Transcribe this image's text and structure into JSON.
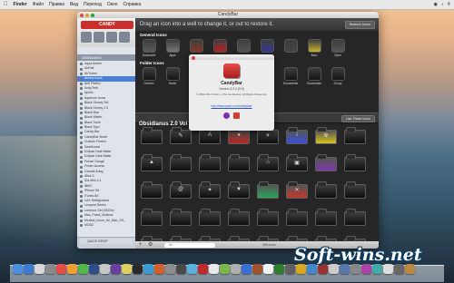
{
  "menubar": {
    "apple": "",
    "items": [
      "Finder",
      "Файл",
      "Правка",
      "Вид",
      "Переход",
      "Окно",
      "Справка"
    ]
  },
  "window": {
    "title": "CandyBar"
  },
  "sidebar": {
    "logo_text": "CANDY",
    "section_header": "OBSIDIANS",
    "items": [
      "Aqua Amber",
      "AirRail",
      "AirTunes",
      "Amora Icons",
      "Anti Firefox",
      "AndyTech",
      "Apollo",
      "Aqueous Icons",
      "Black Glossy Set",
      "Black Glossy 2.0",
      "Black Mac",
      "Black Watch",
      "Black Tools",
      "Black Typo",
      "Candy Bar",
      "CandyBar Mode",
      "Custom Firefox",
      "Dashboard",
      "Eclipse Dark Matte",
      "Eclipse Dark Matte",
      "Ferrari Gauge",
      "Finder Access",
      "Gnome Aring",
      "iDisk X",
      "iOs Mini 4.1",
      "iBMC",
      "iPhone Sit",
      "iTunes 8X",
      "LAX Refrigerated",
      "Leopard Series",
      "Luminox Get (NODs)",
      "Mac_Frank_Buttons",
      "Modest_Icons_for_Mac_OS_",
      "MOD2"
    ],
    "selected_index": 3,
    "quick_drop": "QUICK DROP"
  },
  "main": {
    "hint": "Drag an icon into a well to change it, or out to restore it.",
    "restore_button": "Restore Icons",
    "general_title": "General Icons",
    "general_icons": [
      "Document",
      "Apps",
      "",
      "",
      "",
      "",
      "",
      "Burn",
      "Eject"
    ],
    "folder_title": "Folder Icons",
    "folder_icons": [
      "Generic",
      "Home",
      "",
      "",
      "",
      "System",
      "Documents",
      "Downloads",
      "Group"
    ],
    "pack_title": "Obsidianus 2.0 Vol",
    "use_button": "Use These Icons",
    "search_placeholder": "All",
    "count_label": "399 icons"
  },
  "about": {
    "name": "CandyBar",
    "version": "Version 3.3.4 (9.0)",
    "copyright": "© 2002-2012 Panic + The Iconfactory. All Rights Reserved.",
    "url": "http://www.panic.com/candybar/"
  },
  "watermark": "Soft-wins.net"
}
